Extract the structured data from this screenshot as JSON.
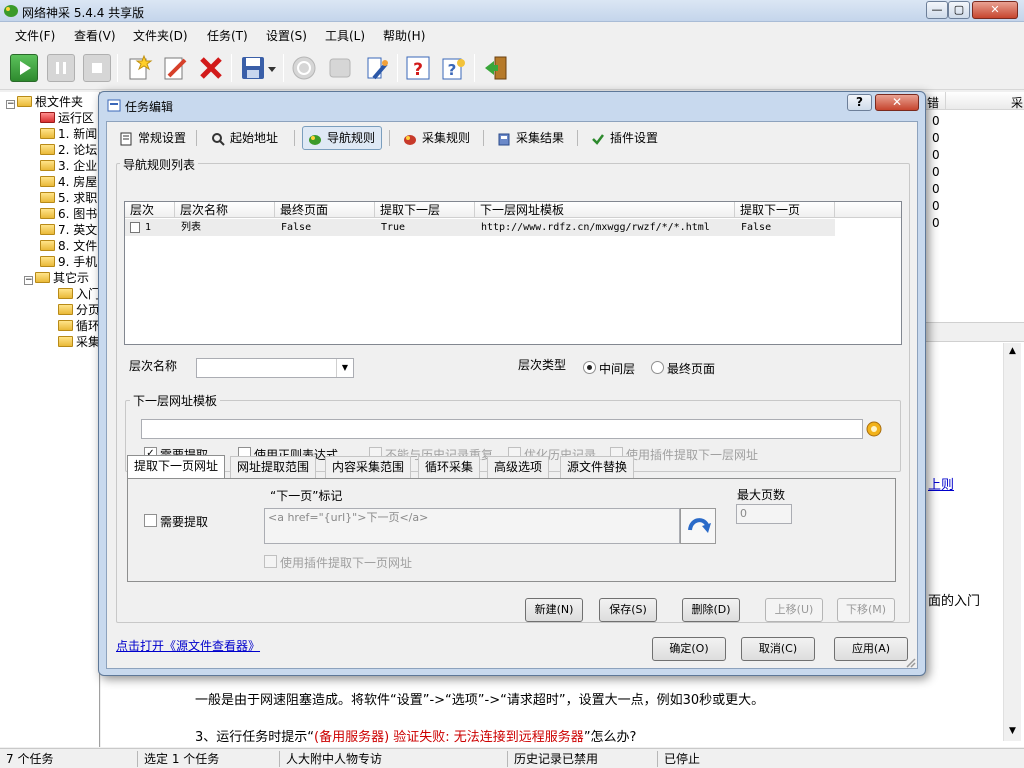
{
  "app": {
    "title": "网络神采 5.4.4 共享版",
    "window_controls": [
      "—",
      "▢",
      "✕"
    ]
  },
  "menu": [
    "文件(F)",
    "查看(V)",
    "文件夹(D)",
    "任务(T)",
    "设置(S)",
    "工具(L)",
    "帮助(H)"
  ],
  "toolbar_icons": [
    "play-icon",
    "pause-icon",
    "stop-icon",
    "new-task-icon",
    "edit-task-icon",
    "delete-task-icon",
    "save-icon",
    "dropdown-arrow-icon",
    "power-icon",
    "export-icon",
    "tools-icon",
    "help-icon",
    "about-icon",
    "exit-icon"
  ],
  "tree": {
    "root": "根文件夹",
    "items": [
      "运行区",
      "1. 新闻",
      "2. 论坛",
      "3. 企业",
      "4. 房屋",
      "5. 求职",
      "6. 图书",
      "7. 英文",
      "8. 文件",
      "9. 手机"
    ],
    "other": "其它示",
    "other_children": [
      "入门",
      "分页",
      "循环",
      "采集"
    ]
  },
  "background": {
    "list_header": [
      "错",
      "采"
    ],
    "list_values": [
      "0",
      "0",
      "0",
      "0",
      "0",
      "0",
      "0"
    ],
    "link_fragment": "上则",
    "text_fragment": "面的入门",
    "line1": "一般是由于网速阻塞造成。将软件“设置”->“选项”->“请求超时”，设置大一点，例如30秒或更大。",
    "line2_prefix": "3、运行任务时提示“",
    "line2_red": "(备用服务器) 验证失败: 无法连接到远程服务器",
    "line2_suffix": "”怎么办?"
  },
  "statusbar": [
    "7 个任务",
    "选定 1 个任务",
    "人大附中人物专访",
    "历史记录已禁用",
    "已停止"
  ],
  "dialog": {
    "title": "任务编辑",
    "help_label": "?",
    "close_label": "✕",
    "tabs": [
      "常规设置",
      "起始地址",
      "导航规则",
      "采集规则",
      "采集结果",
      "插件设置"
    ],
    "active_tab": "导航规则",
    "group_rules_label": "导航规则列表",
    "grid": {
      "headers": [
        "层次",
        "层次名称",
        "最终页面",
        "提取下一层",
        "下一层网址模板",
        "提取下一页"
      ],
      "rows": [
        [
          "1",
          "列表",
          "False",
          "True",
          "http://www.rdfz.cn/mxwgg/rwzf/*/*.html",
          "False"
        ]
      ]
    },
    "level_name_label": "层次名称",
    "level_name_value": "",
    "level_type_label": "层次类型",
    "radio_middle": "中间层",
    "radio_final": "最终页面",
    "next_url_group_label": "下一层网址模板",
    "next_url_value": "",
    "checks": {
      "need_extract": "需要提取",
      "use_regex": "使用正则表达式",
      "no_dup_history": "不能与历史记录重复",
      "optimize_history": "优化历史记录",
      "use_plugin_next_level": "使用插件提取下一层网址"
    },
    "subtabs": [
      "提取下一页网址",
      "网址提取范围",
      "内容采集范围",
      "循环采集",
      "高级选项",
      "源文件替换"
    ],
    "next_page": {
      "need_extract": "需要提取",
      "marker_label": "“下一页”标记",
      "marker_value": "<a href=\"{url}\">下一页</a>",
      "max_pages_label": "最大页数",
      "max_pages_value": "0",
      "use_plugin_label": "使用插件提取下一页网址"
    },
    "buttons": {
      "new": "新建(N)",
      "save": "保存(S)",
      "delete": "删除(D)",
      "move_up": "上移(U)",
      "move_down": "下移(M)",
      "ok": "确定(O)",
      "cancel": "取消(C)",
      "apply": "应用(A)"
    },
    "source_viewer_link": "点击打开《源文件查看器》"
  },
  "colors": {
    "accent_link": "#0000cc",
    "error_red": "#cc0000",
    "dialog_frame": "#c8d9ee"
  }
}
